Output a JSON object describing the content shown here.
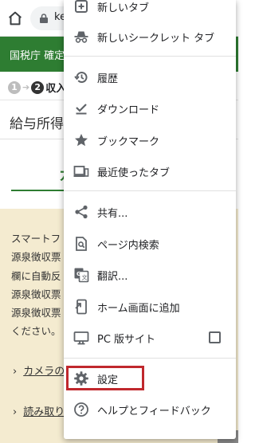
{
  "browser": {
    "url_partial": "ke"
  },
  "page": {
    "header_text": "国税庁 確定",
    "steps": [
      {
        "number": "1",
        "label": ""
      },
      {
        "number": "2",
        "label": "収入"
      }
    ],
    "section_title": "給与所得",
    "big_title": "カ",
    "body_lines": [
      "スマートフ",
      "源泉徴収票",
      "欄に自動反",
      "源泉徴収票",
      "源泉徴収票",
      "ください。"
    ],
    "links": [
      {
        "label": "カメラの"
      },
      {
        "label": "読み取り"
      }
    ]
  },
  "menu": {
    "items": [
      {
        "label": "新しいタブ",
        "icon": "new-tab-icon"
      },
      {
        "label": "新しいシークレット タブ",
        "icon": "incognito-icon"
      },
      {
        "label": "履歴",
        "icon": "history-icon"
      },
      {
        "label": "ダウンロード",
        "icon": "download-icon"
      },
      {
        "label": "ブックマーク",
        "icon": "star-icon"
      },
      {
        "label": "最近使ったタブ",
        "icon": "recent-tabs-icon"
      },
      {
        "label": "共有...",
        "icon": "share-icon"
      },
      {
        "label": "ページ内検索",
        "icon": "find-in-page-icon"
      },
      {
        "label": "翻訳...",
        "icon": "translate-icon"
      },
      {
        "label": "ホーム画面に追加",
        "icon": "add-to-home-icon"
      },
      {
        "label": "PC 版サイト",
        "icon": "desktop-icon",
        "checked": false
      },
      {
        "label": "設定",
        "icon": "settings-icon",
        "highlighted": true
      },
      {
        "label": "ヘルプとフィードバック",
        "icon": "help-icon"
      }
    ]
  },
  "colors": {
    "header_green": "#2e7d32",
    "section_beige": "#f4ebd0",
    "highlight_red": "#c0282d",
    "icon_gray": "#5f6368"
  }
}
